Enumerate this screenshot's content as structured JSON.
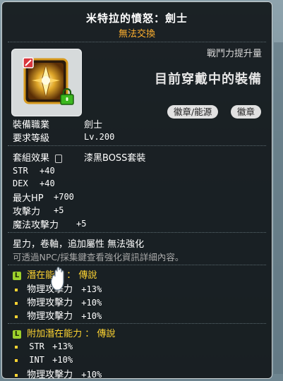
{
  "item": {
    "name": "米特拉的憤怒：劍士",
    "trade_status": "無法交換",
    "combat_power_label": "戰鬥力提升量",
    "current_equipped_label": "目前穿戴中的裝備",
    "tags": [
      "徽章/能源",
      "徽章"
    ]
  },
  "requirements": {
    "job_label": "裝備職業",
    "job_value": "劍士",
    "level_label": "要求等級",
    "level_value": "Lv.200"
  },
  "set": {
    "label": "套組效果",
    "value": "漆黑BOSS套裝"
  },
  "stats": [
    {
      "name": "STR",
      "value": "+40"
    },
    {
      "name": "DEX",
      "value": "+40"
    },
    {
      "name": "最大HP",
      "value": "+700"
    },
    {
      "name": "攻擊力",
      "value": "+5"
    },
    {
      "name": "魔法攻擊力",
      "value": "+5"
    }
  ],
  "notes": {
    "properties": "星力，卷軸，追加屬性 無法強化",
    "hint": "可透過NPC/採集鍵查看強化資訊詳細內容。"
  },
  "potential": {
    "badge": "L",
    "title": "潛在能力 ： 傳說",
    "lines": [
      {
        "name": "物理攻擊力",
        "value": "+13%"
      },
      {
        "name": "物理攻擊力",
        "value": "+10%"
      },
      {
        "name": "物理攻擊力",
        "value": "+10%"
      }
    ]
  },
  "bonus_potential": {
    "badge": "L",
    "title": "附加潛在能力 ： 傳說",
    "lines": [
      {
        "name": "STR",
        "value": "+13%"
      },
      {
        "name": "INT",
        "value": "+10%"
      },
      {
        "name": "物理攻擊力",
        "value": "+10%"
      }
    ]
  },
  "colors": {
    "trade_status": "#ffb02e",
    "potential_title": "#ffd532",
    "legendary_badge": "#9dd12c"
  }
}
